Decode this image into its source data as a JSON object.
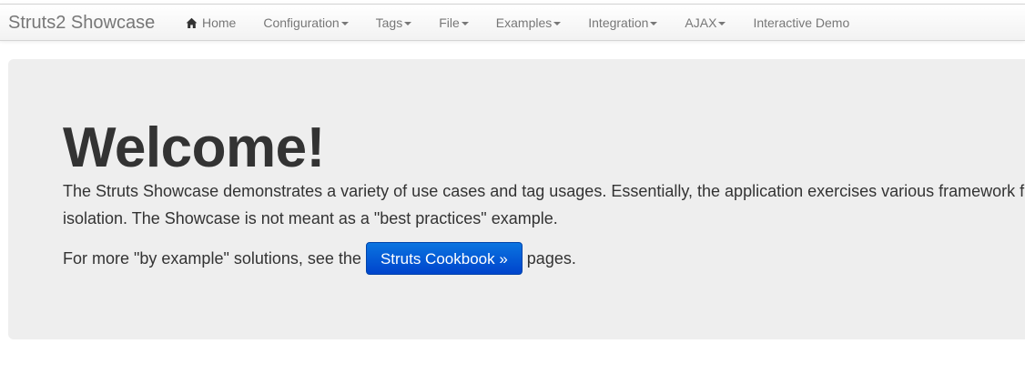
{
  "navbar": {
    "brand": "Struts2 Showcase",
    "items": [
      {
        "label": "Home",
        "icon": "home-icon",
        "dropdown": false
      },
      {
        "label": "Configuration",
        "dropdown": true
      },
      {
        "label": "Tags",
        "dropdown": true
      },
      {
        "label": "File",
        "dropdown": true
      },
      {
        "label": "Examples",
        "dropdown": true
      },
      {
        "label": "Integration",
        "dropdown": true
      },
      {
        "label": "AJAX",
        "dropdown": true
      },
      {
        "label": "Interactive Demo",
        "dropdown": false
      }
    ]
  },
  "hero": {
    "title": "Welcome!",
    "description_line1": "The Struts Showcase demonstrates a variety of use cases and tag usages. Essentially, the application exercises various framework f",
    "description_line2": "isolation. The Showcase is not meant as a \"best practices\" example.",
    "more_prefix": "For more \"by example\" solutions, see the",
    "cookbook_button": "Struts Cookbook »",
    "more_suffix": "pages."
  },
  "colors": {
    "navbar_text": "#777777",
    "hero_background": "#eeeeee",
    "button_primary": "#0055d4",
    "text": "#333333"
  }
}
